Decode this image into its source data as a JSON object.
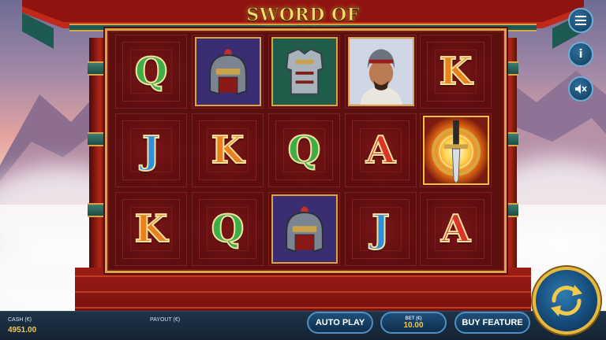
{
  "game": {
    "title": "SWORD OF KHANS"
  },
  "side_buttons": {
    "menu_icon": "hamburger-menu-icon",
    "info_label": "i",
    "sound_icon": "speaker-muted-icon"
  },
  "reels": {
    "rows": [
      [
        "Q",
        "helmet",
        "armor",
        "khan",
        "K"
      ],
      [
        "J",
        "K",
        "Q",
        "A",
        "sword"
      ],
      [
        "K",
        "Q",
        "helmet",
        "J",
        "A"
      ]
    ],
    "letter_colors": {
      "Q": "#3fae47",
      "K": "#e7821e",
      "J": "#2f8fd8",
      "A": "#d9332a"
    }
  },
  "bottom": {
    "cash_label": "CASH (€)",
    "cash_value": "4951.00",
    "payout_label": "PAYOUT (€)",
    "payout_value": "",
    "auto_play_label": "AUTO PLAY",
    "bet_label": "BET (€)",
    "bet_value": "10.00",
    "buy_feature_label": "BUY FEATURE",
    "spin_icon": "spin-arrows-icon"
  },
  "colors": {
    "accent_gold": "#d9a441",
    "panel_blue": "#1e4f7a"
  }
}
